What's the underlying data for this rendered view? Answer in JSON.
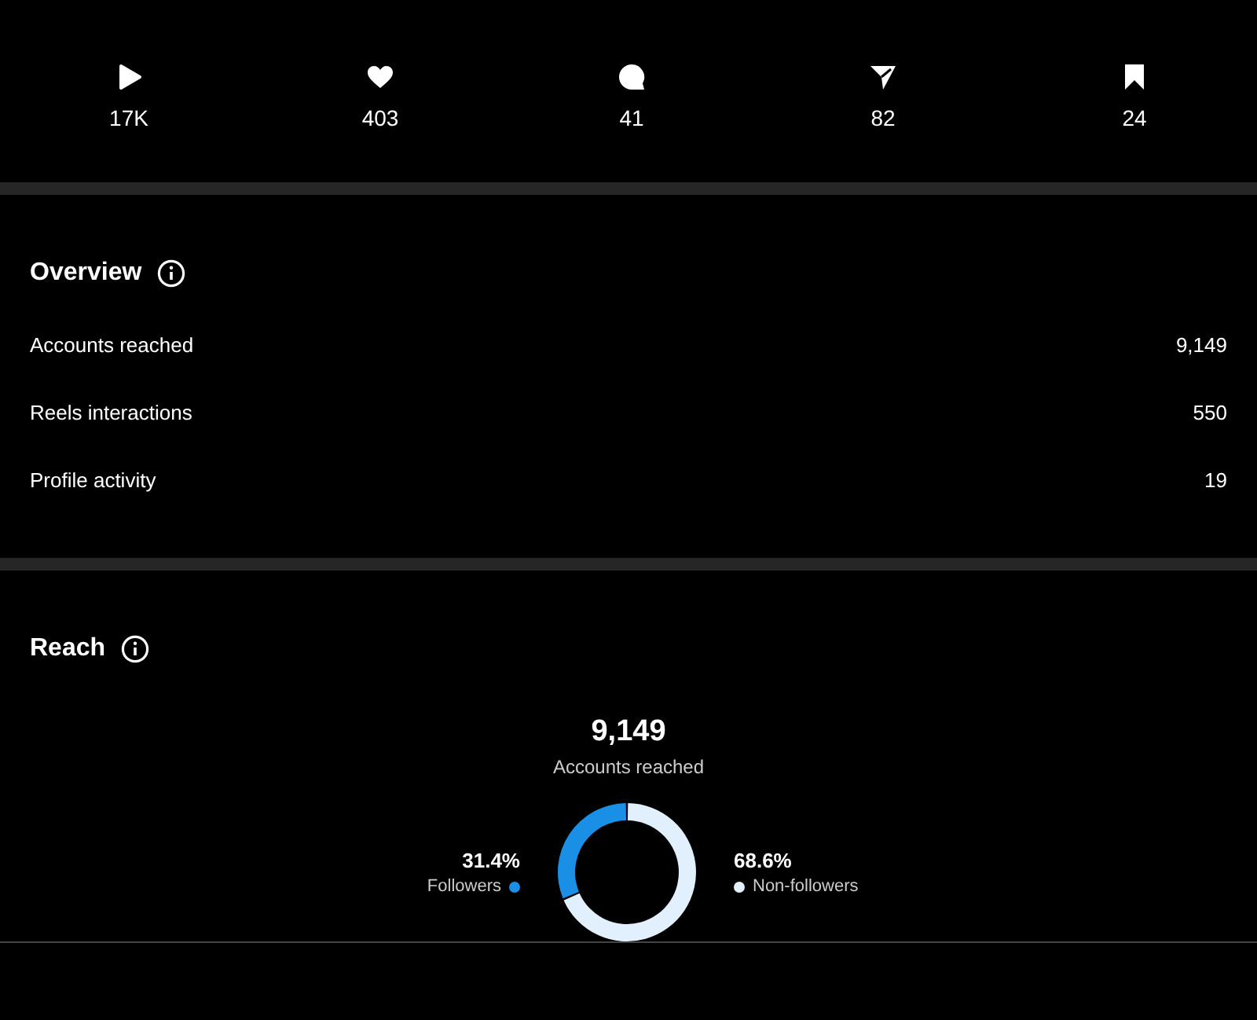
{
  "stats": [
    {
      "kind": "plays",
      "value": "17K"
    },
    {
      "kind": "likes",
      "value": "403"
    },
    {
      "kind": "comments",
      "value": "41"
    },
    {
      "kind": "shares",
      "value": "82"
    },
    {
      "kind": "saves",
      "value": "24"
    }
  ],
  "overview": {
    "title": "Overview",
    "rows": [
      {
        "label": "Accounts reached",
        "value": "9,149"
      },
      {
        "label": "Reels interactions",
        "value": "550"
      },
      {
        "label": "Profile activity",
        "value": "19"
      }
    ]
  },
  "reach": {
    "title": "Reach",
    "total": "9,149",
    "total_label": "Accounts reached",
    "chart_data": {
      "type": "donut",
      "categories": [
        "Followers",
        "Non-followers"
      ],
      "value_labels": [
        "31.4%",
        "68.6%"
      ],
      "values": [
        31.4,
        68.6
      ],
      "colors": [
        "#1a8fe6",
        "#e1f0fc"
      ]
    }
  }
}
